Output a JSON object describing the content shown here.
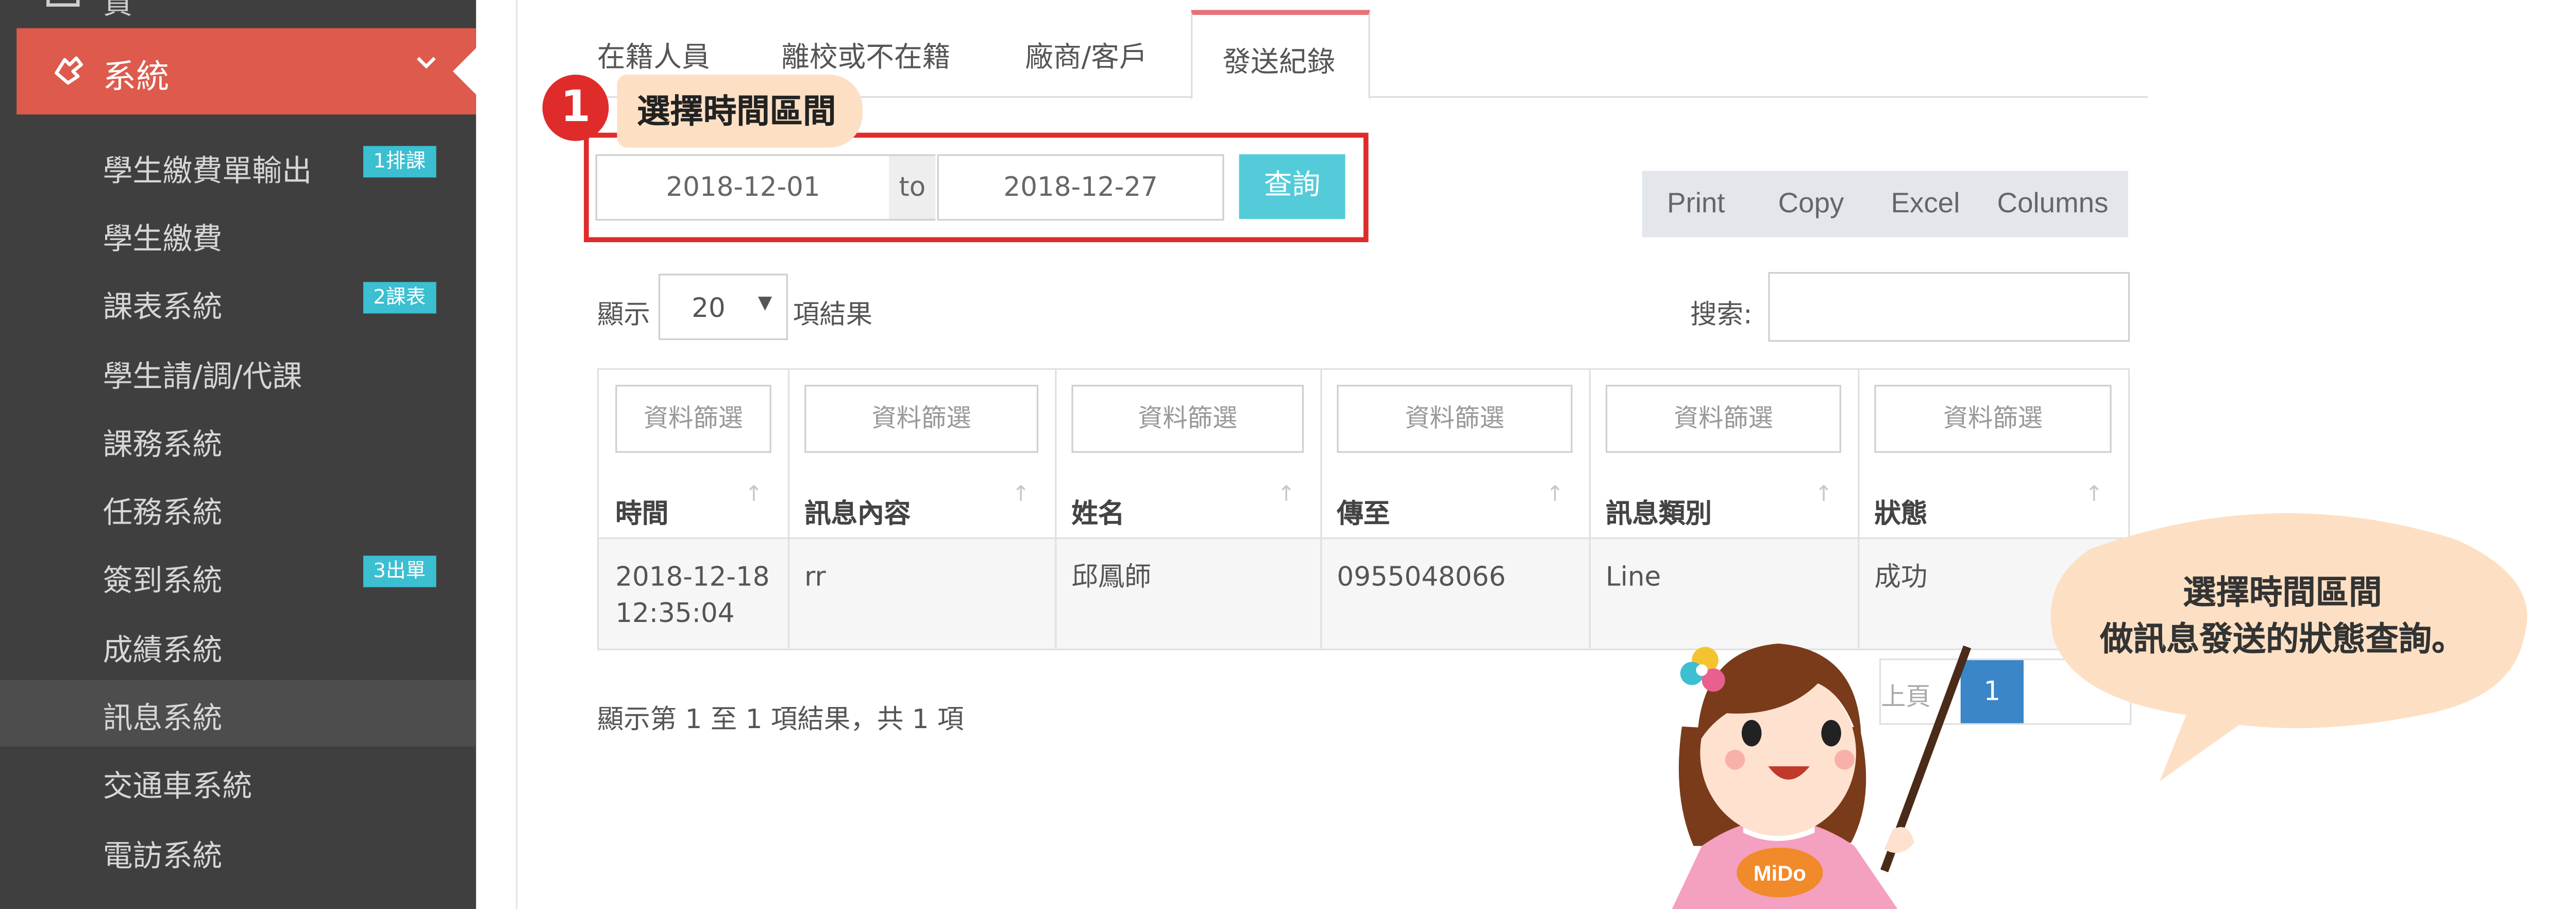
{
  "sidebar": {
    "top_item": "資料",
    "active": {
      "label": "系統"
    },
    "items": [
      {
        "label": "學生繳費單輸出",
        "badge": "1排課"
      },
      {
        "label": "學生繳費",
        "badge": ""
      },
      {
        "label": "課表系統",
        "badge": "2課表"
      },
      {
        "label": "學生請/調/代課",
        "badge": ""
      },
      {
        "label": "課務系統",
        "badge": ""
      },
      {
        "label": "任務系統",
        "badge": ""
      },
      {
        "label": "簽到系統",
        "badge": "3出單"
      },
      {
        "label": "成績系統",
        "badge": ""
      },
      {
        "label": "訊息系統",
        "badge": ""
      },
      {
        "label": "交通車系統",
        "badge": ""
      },
      {
        "label": "電訪系統",
        "badge": ""
      }
    ]
  },
  "tabs": [
    "在籍人員",
    "離校或不在籍",
    "廠商/客戶",
    "發送紀錄"
  ],
  "annotation": {
    "step": "1",
    "label": "選擇時間區間"
  },
  "date_range": {
    "from": "2018-12-01",
    "to_label": "to",
    "to": "2018-12-27",
    "query_button": "查詢"
  },
  "export_buttons": [
    "Print",
    "Copy",
    "Excel",
    "Columns"
  ],
  "length": {
    "prefix": "顯示",
    "value": "20",
    "suffix": "項結果"
  },
  "search": {
    "label": "搜索:"
  },
  "table": {
    "filter_placeholder": "資料篩選",
    "columns": [
      "時間",
      "訊息內容",
      "姓名",
      "傳至",
      "訊息類別",
      "狀態"
    ],
    "rows": [
      {
        "time_date": "2018-12-18",
        "time_clock": "12:35:04",
        "message": "rr",
        "name": "邱鳳師",
        "sent_to": "0955048066",
        "type": "Line",
        "status": "成功"
      }
    ]
  },
  "info": "顯示第 1 至 1 項結果，共 1 項",
  "pagination": {
    "prev": "上頁",
    "current": "1"
  },
  "bubble": {
    "line1": "選擇時間區間",
    "line2": "做訊息發送的狀態查詢。"
  },
  "mascot": {
    "badge": "MiDo"
  },
  "colors": {
    "sidebar_bg": "#3f3f3f",
    "active_menu": "#dd5a4c",
    "badge": "#3bbfd1",
    "query_button": "#54cbd9",
    "pager_active": "#3a86c8",
    "annotation_red": "#e02b2b",
    "bubble_fill": "#fde0c4"
  }
}
